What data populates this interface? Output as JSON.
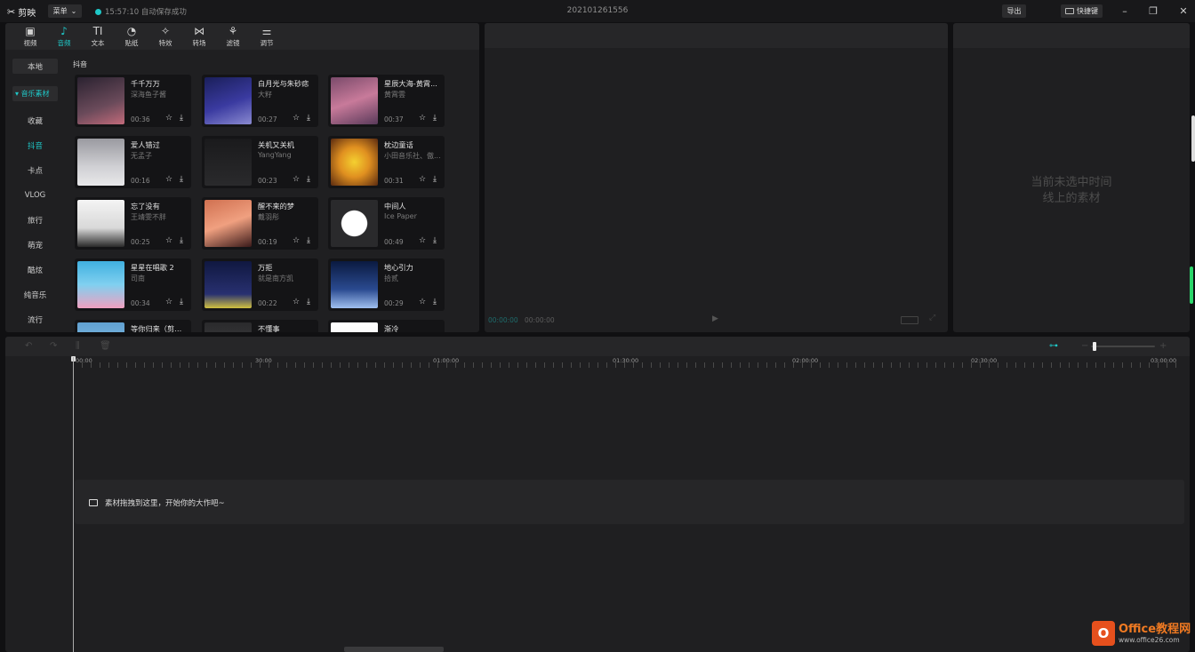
{
  "titlebar": {
    "app_name": "剪映",
    "menu_label": "菜单",
    "save_status": "15:57:10 自动保存成功",
    "project_title": "202101261556",
    "export_label": "导出",
    "shortcut_label": "快捷键"
  },
  "toolbar": {
    "tabs": [
      {
        "label": "视频",
        "icon": "video-icon"
      },
      {
        "label": "音频",
        "icon": "audio-icon"
      },
      {
        "label": "文本",
        "icon": "text-icon"
      },
      {
        "label": "贴纸",
        "icon": "sticker-icon"
      },
      {
        "label": "特效",
        "icon": "effect-icon"
      },
      {
        "label": "转场",
        "icon": "transition-icon"
      },
      {
        "label": "滤镜",
        "icon": "filter-icon"
      },
      {
        "label": "调节",
        "icon": "adjust-icon"
      }
    ],
    "active_tab": "音频"
  },
  "sidebar": {
    "items": [
      {
        "label": "本地"
      },
      {
        "label": "音乐素材"
      },
      {
        "label": "收藏"
      },
      {
        "label": "抖音"
      },
      {
        "label": "卡点"
      },
      {
        "label": "VLOG"
      },
      {
        "label": "旅行"
      },
      {
        "label": "萌宠"
      },
      {
        "label": "酷炫"
      },
      {
        "label": "纯音乐"
      },
      {
        "label": "流行"
      }
    ],
    "active": "抖音"
  },
  "library": {
    "section_title": "抖音",
    "songs": [
      {
        "title": "千千万万",
        "artist": "深海鱼子酱",
        "duration": "00:36"
      },
      {
        "title": "白月光与朱砂痣",
        "artist": "大籽",
        "duration": "00:27"
      },
      {
        "title": "星辰大海-黄霄...",
        "artist": "黄霄雲",
        "duration": "00:37"
      },
      {
        "title": "爱人错过",
        "artist": "无孟子",
        "duration": "00:16"
      },
      {
        "title": "关机又关机",
        "artist": "YangYang",
        "duration": "00:23"
      },
      {
        "title": "枕边童话",
        "artist": "小田音乐社、傲...",
        "duration": "00:31"
      },
      {
        "title": "忘了没有",
        "artist": "王靖雯不胖",
        "duration": "00:25"
      },
      {
        "title": "醒不来的梦",
        "artist": "戴羽彤",
        "duration": "00:19"
      },
      {
        "title": "中间人",
        "artist": "Ice Paper",
        "duration": "00:49"
      },
      {
        "title": "星星在唱歌 2",
        "artist": "司南",
        "duration": "00:34"
      },
      {
        "title": "万拒",
        "artist": "就是南方凯",
        "duration": "00:22"
      },
      {
        "title": "地心引力",
        "artist": "拾贰",
        "duration": "00:29"
      },
      {
        "title": "等你归来（剪辑...",
        "artist": "",
        "duration": ""
      },
      {
        "title": "不懂事",
        "artist": "",
        "duration": ""
      },
      {
        "title": "渐冷",
        "artist": "",
        "duration": ""
      }
    ]
  },
  "player": {
    "current_time": "00:00:00",
    "total_time": "00:00:00"
  },
  "attributes": {
    "empty_line1": "当前未选中时间",
    "empty_line2": "线上的素材"
  },
  "timeline": {
    "ruler_labels": [
      "00:00",
      "30:00",
      "01:00:00",
      "01:30:00",
      "02:00:00",
      "02:30:00",
      "03:00:00"
    ],
    "drop_hint": "素材拖拽到这里，开始你的大作吧~"
  },
  "watermark": {
    "brand": "Office教程网",
    "url": "www.office26.com"
  },
  "colors": {
    "accent": "#1fc8c8",
    "background": "#101012",
    "panel": "#1f1f21"
  }
}
